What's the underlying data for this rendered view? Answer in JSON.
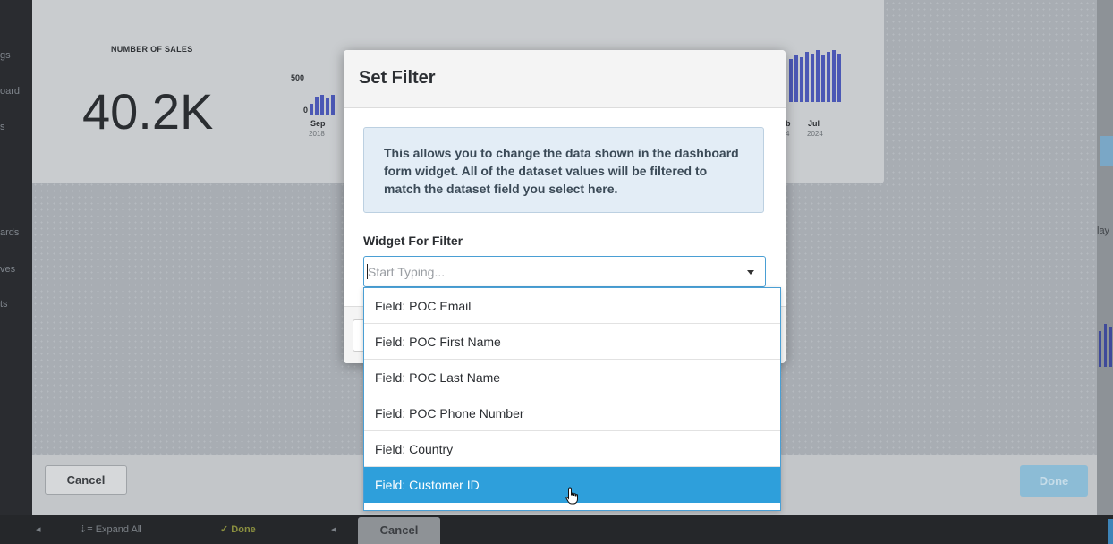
{
  "sidebar": {
    "items": [
      "gs",
      "oard",
      "s",
      "ards",
      "ves",
      "ts"
    ]
  },
  "metric_widget": {
    "label": "NUMBER OF SALES",
    "value": "40.2K",
    "chart_y_tick": "500",
    "chart_y_zero": "0",
    "chart_left_month": "Sep",
    "chart_left_year": "2018",
    "chart_right_month_a": "b",
    "chart_right_year_a": "4",
    "chart_right_month_b": "Jul",
    "chart_right_year_b": "2024"
  },
  "right_strip": {
    "label": "lay"
  },
  "editor_footer": {
    "cancel_label": "Cancel",
    "done_label": "Done"
  },
  "bottom_bar": {
    "expand_all_label": "Expand All",
    "done_label": "Done",
    "cancel_label": "Cancel"
  },
  "modal": {
    "title": "Set Filter",
    "info_text": "This allows you to change the data shown in the dashboard form widget. All of the dataset values will be filtered to match the dataset field you select here.",
    "field_label": "Widget For Filter",
    "combo_placeholder": "Start Typing...",
    "combo_value": ""
  },
  "dropdown": {
    "options": [
      "Field: POC Email",
      "Field: POC First Name",
      "Field: POC Last Name",
      "Field: POC Phone Number",
      "Field: Country",
      "Field: Customer ID"
    ],
    "selected": "Field: Customer ID"
  },
  "colors": {
    "accent": "#2e9fdb",
    "modal_bg": "#ffffff",
    "info_bg": "#e3edf6"
  }
}
